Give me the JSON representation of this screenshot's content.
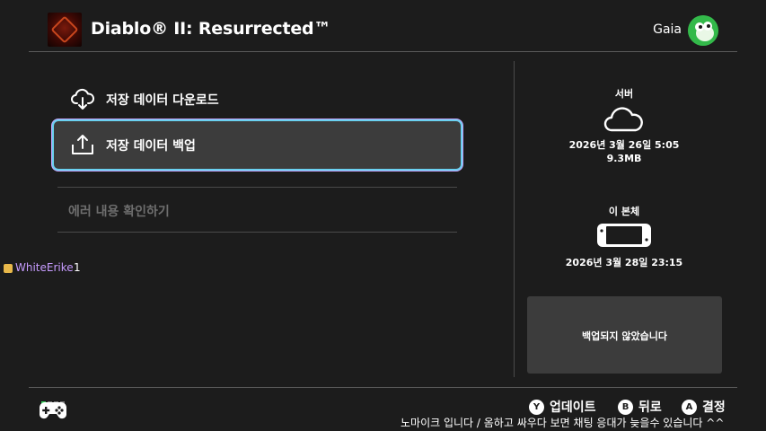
{
  "header": {
    "game_title": "Diablo® II: Resurrected™",
    "user_name": "Gaia"
  },
  "menu": {
    "download_label": "저장 데이터 다운로드",
    "backup_label": "저장 데이터 백업",
    "error_label": "에러 내용 확인하기"
  },
  "server": {
    "label": "서버",
    "date": "2026년 3월 26일 5:05",
    "size": "9.3MB"
  },
  "console": {
    "label": "이 본체",
    "date": "2026년 3월 28일 23:15"
  },
  "status": {
    "text": "백업되지 않았습니다"
  },
  "chat": {
    "user": "WhiteErike",
    "count": "1",
    "ticker": "노마이크 입니다 / 옴하고 싸우다 보면 채팅 응대가 늦을수 있습니다 ^^"
  },
  "footer": {
    "update_key": "Y",
    "update_label": "업데이트",
    "back_key": "B",
    "back_label": "뒤로",
    "ok_key": "A",
    "ok_label": "결정"
  },
  "colors": {
    "background": "#1c1c1c",
    "selection_glow": "#6ad0f0",
    "avatar_green": "#33b94a",
    "chat_user": "#c79cff"
  },
  "icons": {
    "download": "cloud-download-icon",
    "backup": "upload-icon",
    "server": "cloud-icon",
    "console": "switch-console-icon",
    "controller": "controller-icon"
  }
}
